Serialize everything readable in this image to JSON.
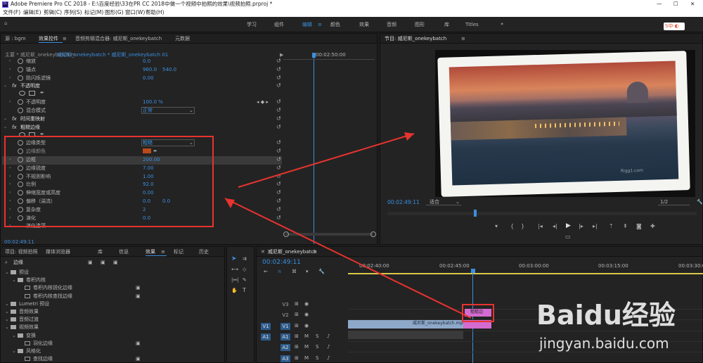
{
  "titlebar": {
    "title": "Adobe Premiere Pro CC 2018 - E:\\百度经验\\33在PR CC 2018中做一个视频中拍照的效果\\视频拍照.prproj *"
  },
  "menu": [
    "文件(F)",
    "编辑(E)",
    "剪辑(C)",
    "序列(S)",
    "标记(M)",
    "图形(G)",
    "窗口(W)",
    "帮助(H)"
  ],
  "workspaces": [
    "学习",
    "组件",
    "编辑",
    "颜色",
    "效果",
    "音频",
    "图形",
    "库",
    "Titles"
  ],
  "active_workspace": "编辑",
  "effect_controls": {
    "tabs": [
      "源 : bgm",
      "效果控件",
      "音频剪辑混合器: 威尼斯_onekeybatch",
      "元数据"
    ],
    "clip_path": "主要 * 威尼斯_onekeybatch.m",
    "seq_path": "威尼斯_onekeybatch * 威尼斯_onekeybatch 01",
    "ruler_time": "00:02:50:00",
    "rows": [
      {
        "label": "缩放",
        "v1": "0.0"
      },
      {
        "label": "锚点",
        "v1": "960.0",
        "v2": "540.0"
      },
      {
        "label": "防闪烁滤镜",
        "v1": "0.00"
      },
      {
        "label": "不透明度"
      },
      {
        "label": "不透明度",
        "v1": "100.0 %"
      },
      {
        "label": "混合模式",
        "v1": "正常"
      },
      {
        "label": "时间重映射"
      },
      {
        "label": "粗糙边缘"
      },
      {
        "label": "边缘类型",
        "v1": "粗糙"
      },
      {
        "label": "边缘颜色"
      },
      {
        "label": "边框",
        "v1": "200.00"
      },
      {
        "label": "边缘锐度",
        "v1": "7.00"
      },
      {
        "label": "不规则影响",
        "v1": "1.00"
      },
      {
        "label": "比例",
        "v1": "92.0"
      },
      {
        "label": "伸缩宽度或高度",
        "v1": "0.00"
      },
      {
        "label": "偏移（湍流）",
        "v1": "0.0",
        "v2": "0.0"
      },
      {
        "label": "复杂度",
        "v1": "2"
      },
      {
        "label": "演化",
        "v1": "0.0"
      },
      {
        "label": "演化选项"
      }
    ],
    "timecode": "00:02:49:11"
  },
  "program": {
    "title": "节目: 威尼斯_onekeybatch",
    "timecode": "00:02:49:11",
    "fit": "适合",
    "quality": "1/2",
    "watermark": "Rigg1.com"
  },
  "project": {
    "tabs": [
      "项目: 视频拍照",
      "媒体浏览器",
      "库",
      "信息",
      "效果",
      "标记",
      "历史"
    ],
    "search_value": "边缘",
    "tree": [
      {
        "label": "预设",
        "indent": 0
      },
      {
        "label": "卷积内核",
        "indent": 1
      },
      {
        "label": "卷积内核锐化边缘",
        "indent": 2
      },
      {
        "label": "卷积内核查找边缘",
        "indent": 2
      },
      {
        "label": "Lumetri 预设",
        "indent": 0
      },
      {
        "label": "音频效果",
        "indent": 0
      },
      {
        "label": "音频过渡",
        "indent": 0
      },
      {
        "label": "视频效果",
        "indent": 0
      },
      {
        "label": "变换",
        "indent": 1
      },
      {
        "label": "羽化边缘",
        "indent": 2
      },
      {
        "label": "风格化",
        "indent": 1
      },
      {
        "label": "查找边缘",
        "indent": 2
      }
    ]
  },
  "timeline": {
    "title": "威尼斯_onekeybatch",
    "timecode": "00:02:49:11",
    "ruler": [
      "00:02:40:00",
      "00:02:45:00",
      "00:03:00:00",
      "00:03:15:00",
      "00:03:30:0"
    ],
    "tracks": [
      "V3",
      "V2",
      "V1",
      "A1",
      "A2",
      "A3"
    ],
    "clip_label": "威尼斯_onekeybatch.mp4 [V]",
    "overlay_label": "粗糙边"
  },
  "watermark": {
    "brand": "Baidu经验",
    "url": "jingyan.baidu.com"
  },
  "colors": {
    "accent": "#3b8fe0",
    "annotation": "#e8332f",
    "clip_video": "#8ea8c9",
    "clip_fx": "#d46bd0"
  }
}
